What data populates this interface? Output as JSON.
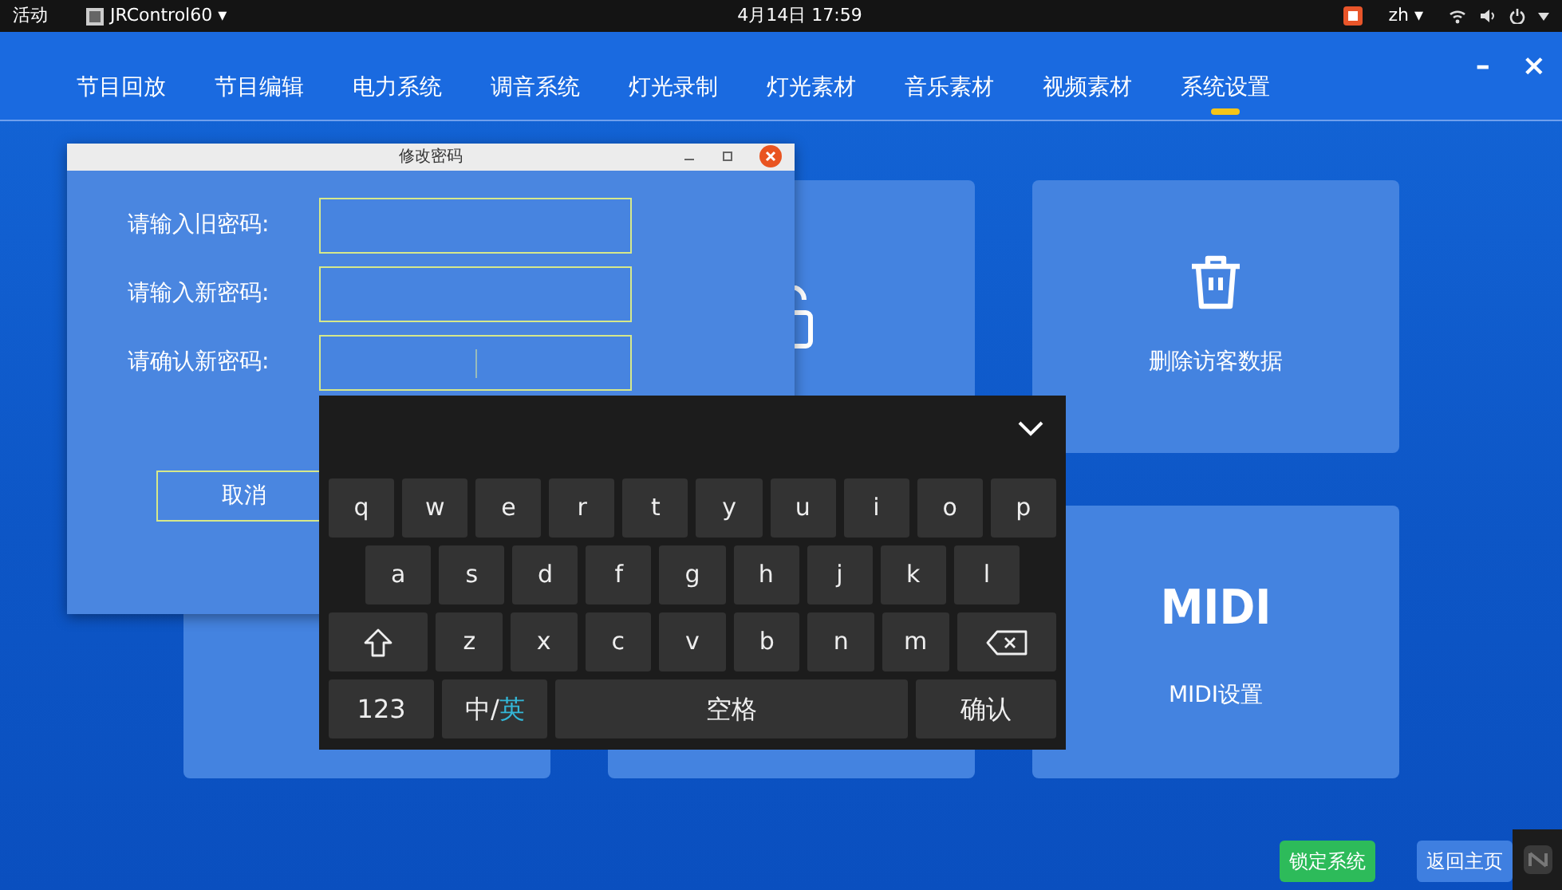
{
  "top_bar": {
    "activities": "活动",
    "app": "JRControl60 ▾",
    "clock": "4月14日 17:59",
    "language": "zh ▾"
  },
  "tabs": [
    {
      "label": "节目回放",
      "selected": false
    },
    {
      "label": "节目编辑",
      "selected": false
    },
    {
      "label": "电力系统",
      "selected": false
    },
    {
      "label": "调音系统",
      "selected": false
    },
    {
      "label": "灯光录制",
      "selected": false
    },
    {
      "label": "灯光素材",
      "selected": false
    },
    {
      "label": "音乐素材",
      "selected": false
    },
    {
      "label": "视频素材",
      "selected": false
    },
    {
      "label": "系统设置",
      "selected": true
    }
  ],
  "window_controls": [
    "–",
    "×"
  ],
  "cards": [
    {
      "kind": "lock"
    },
    {
      "kind": "trash",
      "label": "删除访客数据"
    },
    {
      "kind": "blank"
    },
    {
      "kind": "blank"
    },
    {
      "kind": "midi",
      "icon_text": "MIDI",
      "label": "MIDI设置"
    }
  ],
  "footer_buttons": [
    {
      "label": "锁定系统",
      "kind": "success"
    },
    {
      "label": "返回主页",
      "kind": "primary"
    }
  ],
  "dialog": {
    "title": "修改密码",
    "fields": [
      {
        "label": "请输入旧密码:",
        "focused": false
      },
      {
        "label": "请输入新密码:",
        "focused": false
      },
      {
        "label": "请确认新密码:",
        "focused": true
      }
    ],
    "cancel": "取消"
  },
  "keyboard": {
    "rows": [
      [
        {
          "kind": "char",
          "label": "q"
        },
        {
          "kind": "char",
          "label": "w"
        },
        {
          "kind": "char",
          "label": "e"
        },
        {
          "kind": "char",
          "label": "r"
        },
        {
          "kind": "char",
          "label": "t"
        },
        {
          "kind": "char",
          "label": "y"
        },
        {
          "kind": "char",
          "label": "u"
        },
        {
          "kind": "char",
          "label": "i"
        },
        {
          "kind": "char",
          "label": "o"
        },
        {
          "kind": "char",
          "label": "p"
        }
      ],
      [
        {
          "kind": "char",
          "label": "a"
        },
        {
          "kind": "char",
          "label": "s"
        },
        {
          "kind": "char",
          "label": "d"
        },
        {
          "kind": "char",
          "label": "f"
        },
        {
          "kind": "char",
          "label": "g"
        },
        {
          "kind": "char",
          "label": "h"
        },
        {
          "kind": "char",
          "label": "j"
        },
        {
          "kind": "char",
          "label": "k"
        },
        {
          "kind": "char",
          "label": "l"
        }
      ],
      [
        {
          "kind": "shift"
        },
        {
          "kind": "char",
          "label": "z"
        },
        {
          "kind": "char",
          "label": "x"
        },
        {
          "kind": "char",
          "label": "c"
        },
        {
          "kind": "char",
          "label": "v"
        },
        {
          "kind": "char",
          "label": "b"
        },
        {
          "kind": "char",
          "label": "n"
        },
        {
          "kind": "char",
          "label": "m"
        },
        {
          "kind": "backspace"
        }
      ],
      [
        {
          "kind": "mode",
          "label": "123"
        },
        {
          "kind": "lang",
          "label": "中/",
          "accent": "英"
        },
        {
          "kind": "space",
          "label": "空格"
        },
        {
          "kind": "enter",
          "label": "确认"
        }
      ]
    ]
  }
}
